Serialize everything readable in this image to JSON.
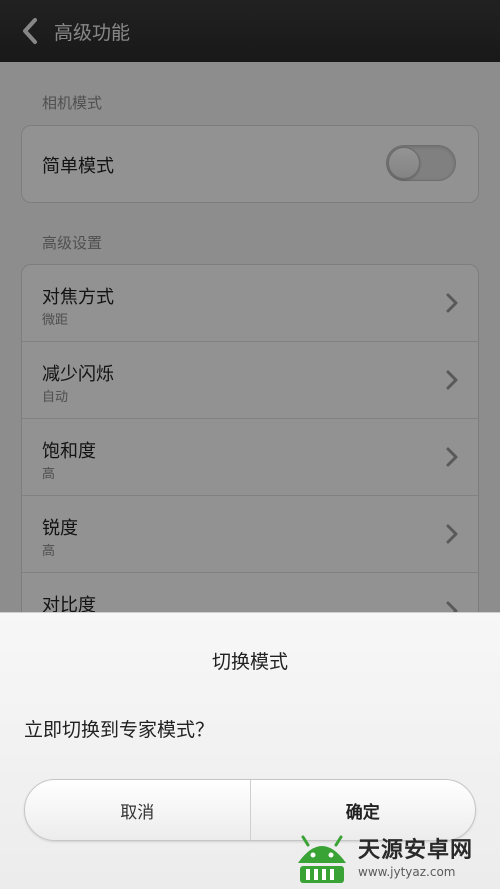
{
  "header": {
    "title": "高级功能",
    "back_icon": "chevron-left-icon"
  },
  "sections": {
    "camera_mode": {
      "label": "相机模式",
      "items": [
        {
          "title": "简单模式",
          "toggle": "off"
        }
      ]
    },
    "advanced": {
      "label": "高级设置",
      "items": [
        {
          "title": "对焦方式",
          "value": "微距"
        },
        {
          "title": "减少闪烁",
          "value": "自动"
        },
        {
          "title": "饱和度",
          "value": "高"
        },
        {
          "title": "锐度",
          "value": "高"
        },
        {
          "title": "对比度",
          "value": ""
        }
      ]
    }
  },
  "dialog": {
    "title": "切换模式",
    "message": "立即切换到专家模式？",
    "cancel_label": "取消",
    "confirm_label": "确定"
  },
  "watermark": {
    "title": "天源安卓网",
    "url": "www.jytyaz.com"
  },
  "colors": {
    "header_bg": "#2f2f2f",
    "overlay": "rgba(0,0,0,0.42)",
    "watermark_green": "#3aa335"
  }
}
